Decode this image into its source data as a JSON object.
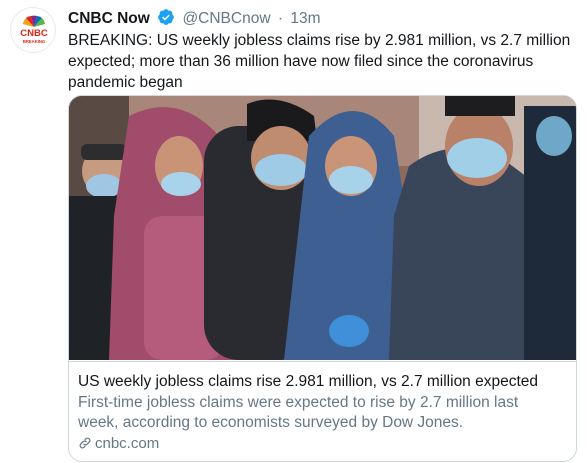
{
  "tweet": {
    "avatar_icon": "cnbc-peacock-logo",
    "avatar_text": "CNBC",
    "avatar_subtext": "BREAKING",
    "author_name": "CNBC Now",
    "verified_icon": "verified-badge-icon",
    "handle": "@CNBCnow",
    "separator": "·",
    "time": "13m",
    "text": "BREAKING: US weekly jobless claims rise by 2.981 million, vs 2.7 million expected; more than 36 million have now filed since the coronavirus pandemic began"
  },
  "card": {
    "image_alt": "photo-people-in-face-masks-waiting-in-line",
    "title": "US weekly jobless claims rise 2.981 million, vs 2.7 million expected",
    "description": "First-time jobless claims were expected to rise by 2.7 million last week, according to economists surveyed by Dow Jones.",
    "link_icon": "link-icon",
    "domain": "cnbc.com"
  },
  "colors": {
    "verified": "#1da1f2",
    "secondary_text": "#657786",
    "border": "#ccd6dd",
    "cnbc_red": "#e2231a"
  }
}
